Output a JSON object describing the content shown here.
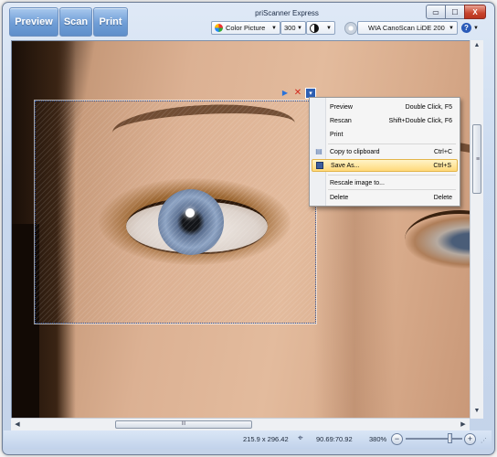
{
  "app": {
    "title": "priScanner Express"
  },
  "toolbar": {
    "preview_label": "Preview",
    "scan_label": "Scan",
    "print_label": "Print",
    "color_mode": "Color Picture",
    "resolution": "300",
    "scanner": "WIA CanoScan LiDE 200",
    "help_glyph": "?"
  },
  "window_controls": {
    "minimize": "▭",
    "maximize": "☐",
    "close": "X"
  },
  "selection_tools": {
    "play": "▶",
    "close": "✕",
    "menu": "▾"
  },
  "context_menu": {
    "items": [
      {
        "label": "Preview",
        "shortcut": "Double Click, F5",
        "icon": ""
      },
      {
        "label": "Rescan",
        "shortcut": "Shift+Double Click, F6",
        "icon": ""
      },
      {
        "label": "Print",
        "shortcut": "",
        "icon": ""
      },
      {
        "label": "Copy to clipboard",
        "shortcut": "Ctrl+C",
        "icon": "clipboard-icon"
      },
      {
        "label": "Save As...",
        "shortcut": "Ctrl+S",
        "icon": "floppy-disk-icon",
        "highlighted": true
      },
      {
        "label": "Rescale image to...",
        "shortcut": "",
        "icon": ""
      },
      {
        "label": "Delete",
        "shortcut": "Delete",
        "icon": ""
      }
    ]
  },
  "scrollbars": {
    "h_thumb_grip": "III"
  },
  "status": {
    "size": "215.9 x 296.42",
    "position": "90.69:70.92",
    "zoom": "380%"
  },
  "colors": {
    "accent": "#5f8fca",
    "menu_highlight": "#ffd979",
    "selection_border": "#2b4f95"
  }
}
